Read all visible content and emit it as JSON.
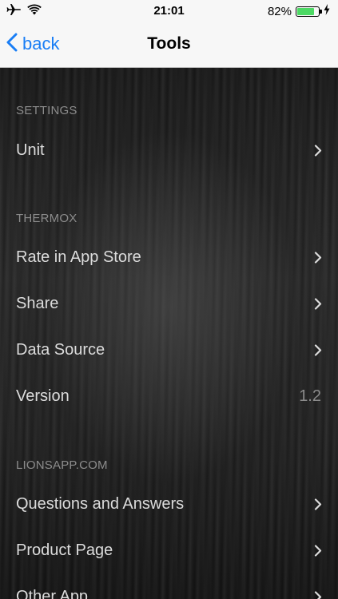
{
  "status_bar": {
    "time": "21:01",
    "battery_percent": "82%",
    "battery_level": 0.82,
    "icons": [
      "airplane-icon",
      "wifi-icon",
      "battery-icon",
      "charging-bolt-icon"
    ]
  },
  "nav": {
    "back_label": "back",
    "title": "Tools",
    "accent_color": "#1a7ef5"
  },
  "sections": {
    "settings": {
      "header": "SETTINGS",
      "items": [
        {
          "label": "Unit",
          "icon": "chevron-right-icon"
        }
      ]
    },
    "thermox": {
      "header": "THERMOX",
      "items": [
        {
          "label": "Rate in App Store",
          "icon": "chevron-right-icon"
        },
        {
          "label": "Share",
          "icon": "chevron-right-icon"
        },
        {
          "label": "Data Source",
          "icon": "chevron-right-icon"
        },
        {
          "label": "Version",
          "value": "1.2"
        }
      ]
    },
    "lionsapp": {
      "header": "LIONSAPP.COM",
      "items": [
        {
          "label": "Questions and Answers",
          "icon": "chevron-right-icon"
        },
        {
          "label": "Product Page",
          "icon": "chevron-right-icon"
        },
        {
          "label": "Other App",
          "icon": "chevron-right-icon"
        }
      ]
    }
  }
}
